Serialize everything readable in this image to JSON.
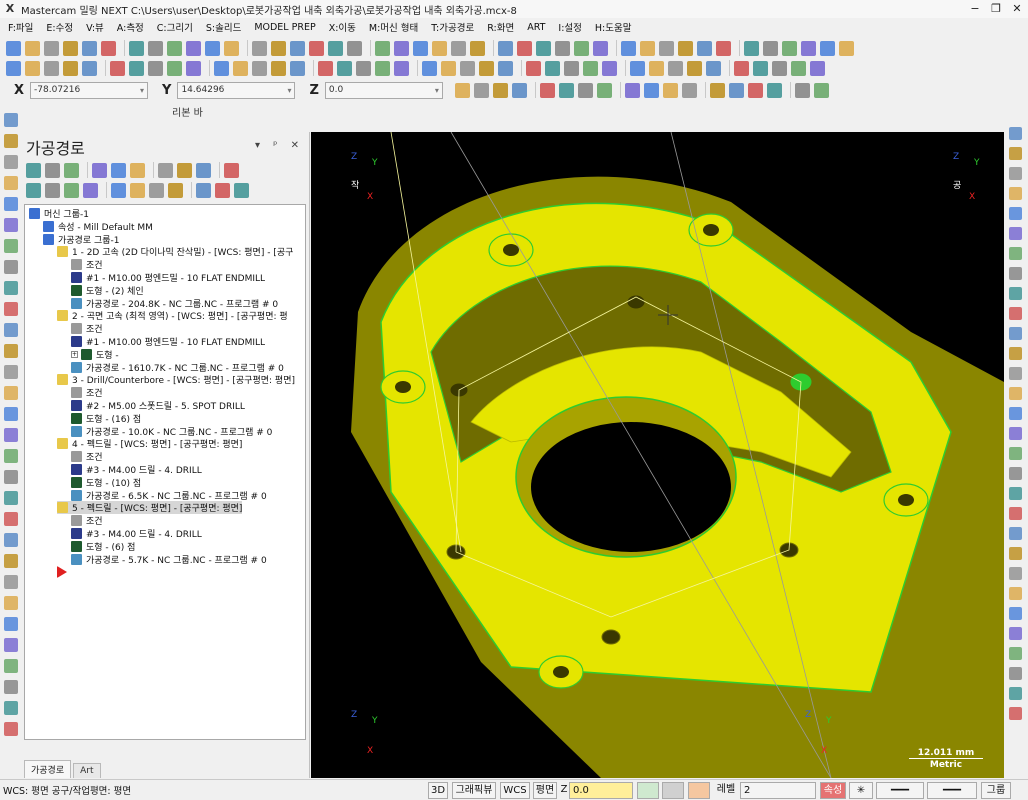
{
  "window": {
    "title": "Mastercam 밀링 NEXT  C:\\Users\\user\\Desktop\\로봇가공작업 내축 외축가공\\로봇가공작업 내축 외축가공.mcx-8",
    "logo": "X",
    "minimize": "−",
    "restore": "❐",
    "close": "✕"
  },
  "menu": [
    "F:파일",
    "E:수정",
    "V:뷰",
    "A:측정",
    "C:그리기",
    "S:솔리드",
    "MODEL PREP",
    "X:이동",
    "M:머신 형태",
    "T:가공경로",
    "R:화면",
    "ART",
    "I:설정",
    "H:도움말"
  ],
  "coords": {
    "x_label": "X",
    "x_value": "-78.07216",
    "y_label": "Y",
    "y_value": "14.64296",
    "z_label": "Z",
    "z_value": "0.0"
  },
  "ribbon_label": "리본 바",
  "panel": {
    "title": "가공경로",
    "controls": "▾ ᵖ ✕",
    "tree": [
      {
        "indent": 0,
        "icon": "machine-group-icon",
        "text": "머신 그룹-1"
      },
      {
        "indent": 1,
        "icon": "properties-icon",
        "text": "속성 - Mill Default MM"
      },
      {
        "indent": 1,
        "icon": "toolpath-group-icon",
        "text": "가공경로 그룹-1"
      },
      {
        "indent": 2,
        "icon": "folder-icon",
        "text": "1 - 2D 고속 (2D 다이나믹 잔삭밀) - [WCS: 평면] - [공구"
      },
      {
        "indent": 3,
        "icon": "parameters-icon",
        "text": "조건"
      },
      {
        "indent": 3,
        "icon": "tool-icon",
        "text": "#1 - M10.00 평엔드밀 - 10 FLAT ENDMILL"
      },
      {
        "indent": 3,
        "icon": "geometry-icon",
        "text": "도형 - (2) 체인"
      },
      {
        "indent": 3,
        "icon": "toolpath-wave-icon",
        "text": "가공경로 - 204.8K - NC 그룹.NC - 프로그램 # 0"
      },
      {
        "indent": 2,
        "icon": "folder-icon",
        "text": "2 - 곡면 고속 (최적 영역) - [WCS: 평면] - [공구평면: 평"
      },
      {
        "indent": 3,
        "icon": "parameters-icon",
        "text": "조건"
      },
      {
        "indent": 3,
        "icon": "tool-icon",
        "text": "#1 - M10.00 평엔드밀 - 10 FLAT ENDMILL"
      },
      {
        "indent": 3,
        "icon": "geometry-icon",
        "text": "도형 -",
        "expander": true
      },
      {
        "indent": 3,
        "icon": "toolpath-wave-icon",
        "text": "가공경로 - 1610.7K - NC 그룹.NC - 프로그램 # 0"
      },
      {
        "indent": 2,
        "icon": "folder-icon",
        "text": "3 - Drill/Counterbore - [WCS: 평면] - [공구평면: 평면]"
      },
      {
        "indent": 3,
        "icon": "parameters-icon",
        "text": "조건"
      },
      {
        "indent": 3,
        "icon": "tool-icon",
        "text": "#2 - M5.00 스폿드릴 - 5. SPOT DRILL"
      },
      {
        "indent": 3,
        "icon": "geometry-icon",
        "text": "도형 - (16) 점"
      },
      {
        "indent": 3,
        "icon": "toolpath-wave-icon",
        "text": "가공경로 - 10.0K - NC 그룹.NC - 프로그램 # 0"
      },
      {
        "indent": 2,
        "icon": "folder-icon",
        "text": "4 - 펙드릴 - [WCS: 평면] - [공구평면: 평면]"
      },
      {
        "indent": 3,
        "icon": "parameters-icon",
        "text": "조건"
      },
      {
        "indent": 3,
        "icon": "tool-icon",
        "text": "#3 - M4.00 드릴 - 4. DRILL"
      },
      {
        "indent": 3,
        "icon": "geometry-icon",
        "text": "도형 - (10) 점"
      },
      {
        "indent": 3,
        "icon": "toolpath-wave-icon",
        "text": "가공경로 - 6.5K - NC 그룹.NC - 프로그램 # 0"
      },
      {
        "indent": 2,
        "icon": "folder-icon",
        "text": "5 - 펙드릴 - [WCS: 평면] - [공구평면: 평면]",
        "selected": true
      },
      {
        "indent": 3,
        "icon": "parameters-icon",
        "text": "조건"
      },
      {
        "indent": 3,
        "icon": "tool-icon",
        "text": "#3 - M4.00 드릴 - 4. DRILL"
      },
      {
        "indent": 3,
        "icon": "geometry-icon",
        "text": "도형 - (6) 점"
      },
      {
        "indent": 3,
        "icon": "toolpath-wave-icon",
        "text": "가공경로 - 5.7K - NC 그룹.NC - 프로그램 # 0"
      },
      {
        "indent": 2,
        "icon": "insert-arrow-icon",
        "text": ""
      }
    ],
    "tabs": [
      "가공경로",
      "Art"
    ]
  },
  "viewport": {
    "axis_labels": {
      "top_left": "작",
      "top_right": "공",
      "x": "X",
      "y": "Y",
      "z": "Z"
    },
    "scale_value": "12.011 mm",
    "scale_unit": "Metric",
    "colors": {
      "part": "#e5e500",
      "part_dark": "#8a8600",
      "edge": "#2ecc2e",
      "background": "#000000"
    }
  },
  "status": {
    "wcs_text": "WCS: 평면  공구/작업평면: 평면",
    "mode_3d": "3D",
    "graphic_view": "그래픽뷰",
    "wcs_btn": "WCS",
    "plane": "평면",
    "z_label": "Z",
    "z_value": "0.0",
    "level_label": "레벨",
    "level_value": "2",
    "attr": "속성",
    "group": "그룹"
  }
}
